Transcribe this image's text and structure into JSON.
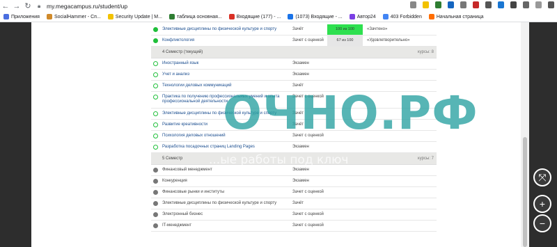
{
  "browser": {
    "url": "my.megacampus.ru/student/up",
    "bookmarks": [
      {
        "label": "Приложения",
        "color": "#4a6ee0"
      },
      {
        "label": "SocialHammer - Сп...",
        "color": "#d08a2a"
      },
      {
        "label": "Security Update | M...",
        "color": "#f2c200"
      },
      {
        "label": "таблица основная...",
        "color": "#2e7d32"
      },
      {
        "label": "Входящие (177) - ...",
        "color": "#d93025"
      },
      {
        "label": "(1073) Входящие - ...",
        "color": "#1a73e8"
      },
      {
        "label": "Автор24",
        "color": "#7b3fe4"
      },
      {
        "label": "403 Forbidden",
        "color": "#4285f4"
      },
      {
        "label": "Начальная страница",
        "color": "#ff6d00"
      }
    ]
  },
  "rows_top": [
    {
      "name": "Элективные дисциплины по физической культуре и спорту",
      "type": "Зачёт",
      "score": "100 из 100",
      "grade": "«Зачтено»",
      "status": "done",
      "score_bg": "#2ee04f"
    },
    {
      "name": "Конфликтология",
      "type": "Зачет с оценкой",
      "score": "67 из 100",
      "grade": "«Удовлетворительно»",
      "status": "done",
      "score_bg": "#e6e6e6"
    }
  ],
  "semester4": {
    "title": "4   Семестр (текущий)",
    "count": "курсы: 8"
  },
  "rows_sem4": [
    {
      "name": "Иностранный язык",
      "type": "Экзамен"
    },
    {
      "name": "Учет и анализ",
      "type": "Экзамен"
    },
    {
      "name": "Технологии деловых коммуникаций",
      "type": "Зачёт"
    },
    {
      "name": "Практика по получению профессиональных умений и опыта профессиональной деятельности",
      "type": "Зачет с оценкой",
      "tall": true
    },
    {
      "name": "Элективные дисциплины по физической культуре и спорту",
      "type": "Зачёт"
    },
    {
      "name": "Развитие креативности",
      "type": "Зачёт"
    },
    {
      "name": "Психология деловых отношений",
      "type": "Зачет с оценкой"
    },
    {
      "name": "Разработка посадочных страниц Landing Pages",
      "type": "Экзамен"
    }
  ],
  "semester5": {
    "title": "5   Семестр",
    "count": "курсы: 7"
  },
  "rows_sem5": [
    {
      "name": "Финансовый менеджмент",
      "type": "Экзамен"
    },
    {
      "name": "Конкуренция",
      "type": "Экзамен"
    },
    {
      "name": "Финансовые рынки и институты",
      "type": "Зачет с оценкой"
    },
    {
      "name": "Элективные дисциплины по физической культуре и спорту",
      "type": "Зачёт"
    },
    {
      "name": "Электронный бизнес",
      "type": "Зачет с оценкой"
    },
    {
      "name": "IT-менеджмент",
      "type": "Зачет с оценкой"
    }
  ],
  "watermark": {
    "main": "ОЧНО.РФ",
    "sub": "...ые работы под ключ"
  },
  "zoom": {
    "fit": "⤧",
    "plus": "+",
    "minus": "−"
  }
}
